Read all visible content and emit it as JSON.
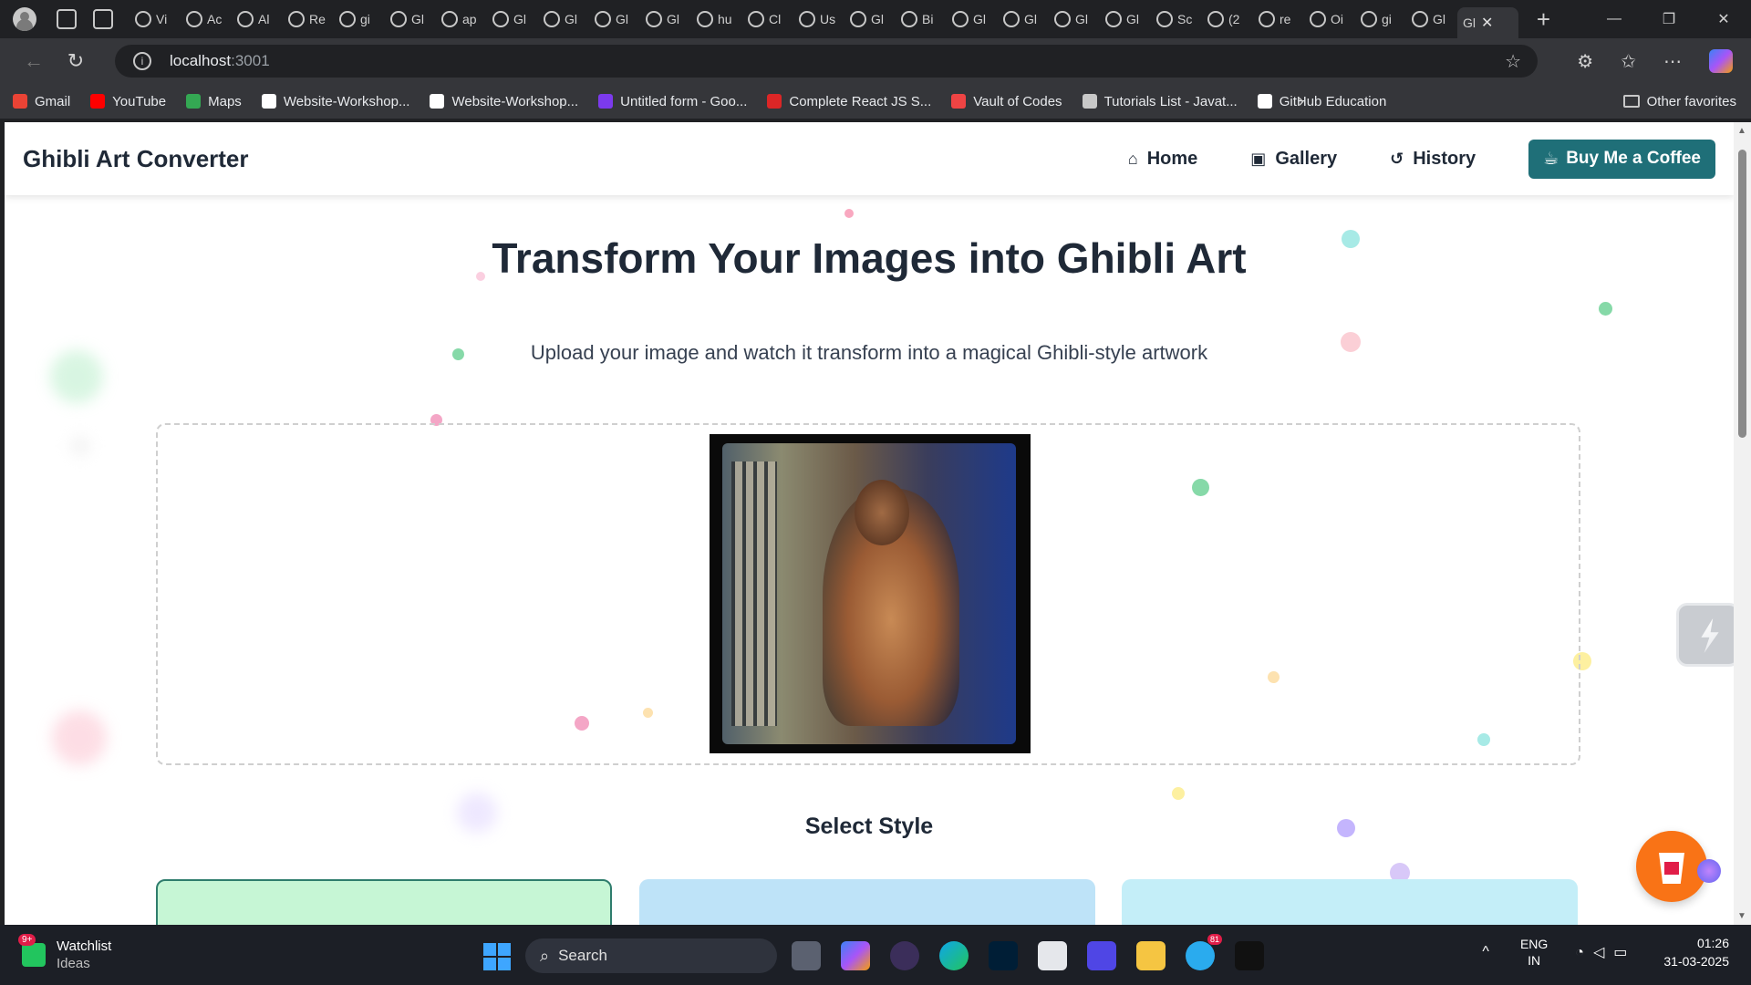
{
  "browser": {
    "tabs": [
      "Vi",
      "Ac",
      "Al",
      "Re",
      "gi",
      "Gl",
      "ap",
      "Gl",
      "Gl",
      "Gl",
      "Gl",
      "hu",
      "Cl",
      "Us",
      "Gl",
      "Bi",
      "Gl",
      "Gl",
      "Gl",
      "Gl",
      "Sc",
      "(2",
      "re",
      "Oi",
      "gi",
      "Gl"
    ],
    "active_tab": "Gl",
    "url_host": "localhost",
    "url_port": ":3001",
    "bookmarks": [
      {
        "label": "Gmail",
        "color": "#ea4335"
      },
      {
        "label": "YouTube",
        "color": "#ff0000"
      },
      {
        "label": "Maps",
        "color": "#34a853"
      },
      {
        "label": "Website-Workshop...",
        "color": "#ffffff"
      },
      {
        "label": "Website-Workshop...",
        "color": "#ffffff"
      },
      {
        "label": "Untitled form - Goo...",
        "color": "#7c3aed"
      },
      {
        "label": "Complete React JS S...",
        "color": "#dc2626"
      },
      {
        "label": "Vault of Codes",
        "color": "#ef4444"
      },
      {
        "label": "Tutorials List - Javat...",
        "color": "#c8c8c8"
      },
      {
        "label": "GitHub Education",
        "color": "#ffffff"
      }
    ],
    "other_favorites": "Other favorites"
  },
  "page": {
    "brand": "Ghibli Art Converter",
    "nav": {
      "home": "Home",
      "gallery": "Gallery",
      "history": "History",
      "coffee": "Buy Me a Coffee"
    },
    "title": "Transform Your Images into Ghibli Art",
    "subtitle": "Upload your image and watch it transform into a magical Ghibli-style artwork",
    "select_style": "Select Style"
  },
  "taskbar": {
    "watchlist_title": "Watchlist",
    "watchlist_sub": "Ideas",
    "watch_badge": "9+",
    "search_placeholder": "Search",
    "telegram_badge": "81",
    "lang_top": "ENG",
    "lang_bottom": "IN",
    "time": "01:26",
    "date": "31-03-2025"
  },
  "colors": {
    "accent": "#1f6f78",
    "fab": "#f97316"
  }
}
